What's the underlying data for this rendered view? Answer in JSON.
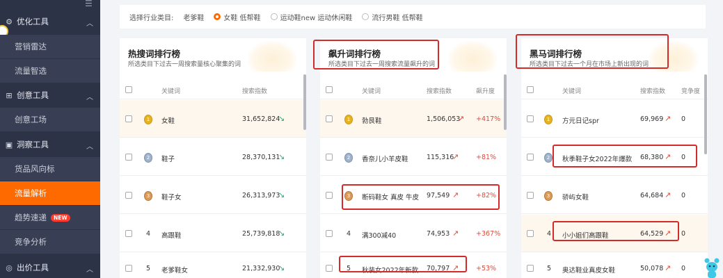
{
  "sidebar": {
    "groups": [
      {
        "label": "优化工具",
        "icon": "gear-icon"
      },
      {
        "label": "创意工具",
        "icon": "idea-icon"
      },
      {
        "label": "洞察工具",
        "icon": "insight-icon"
      },
      {
        "label": "出价工具",
        "icon": "bid-icon"
      }
    ],
    "items": [
      {
        "label": "营销雷达"
      },
      {
        "label": "流量智选"
      },
      {
        "label": "创意工场"
      },
      {
        "label": "货品风向标"
      },
      {
        "label": "流量解析"
      },
      {
        "label": "趋势速递",
        "badge": "NEW"
      },
      {
        "label": "竞争分析"
      }
    ],
    "active_color": "#ff6a00"
  },
  "filter": {
    "label": "选择行业类目:",
    "category": "老爹鞋",
    "options": [
      {
        "label": "女鞋 低帮鞋",
        "selected": true
      },
      {
        "label": "运动鞋new 运动休闲鞋",
        "selected": false
      },
      {
        "label": "流行男鞋 低帮鞋",
        "selected": false
      }
    ]
  },
  "cards": [
    {
      "title": "热搜词排行榜",
      "subtitle": "所选类目下过去一周搜索量核心聚集的词",
      "headers": [
        "关键词",
        "搜索指数"
      ],
      "rows": [
        {
          "rank": "1",
          "keyword": "女鞋",
          "index": "31,652,824",
          "trend": "down"
        },
        {
          "rank": "2",
          "keyword": "鞋子",
          "index": "28,370,131",
          "trend": "down"
        },
        {
          "rank": "3",
          "keyword": "鞋子女",
          "index": "26,313,973",
          "trend": "down"
        },
        {
          "rank": "4",
          "keyword": "高跟鞋",
          "index": "25,739,818",
          "trend": "down"
        },
        {
          "rank": "5",
          "keyword": "老爹鞋女",
          "index": "21,332,930",
          "trend": "down"
        }
      ]
    },
    {
      "title": "飙升词排行榜",
      "subtitle": "所选类目下过去一周搜索流量飙升的词",
      "headers": [
        "关键词",
        "搜索指数",
        "飙升度"
      ],
      "rows": [
        {
          "rank": "1",
          "keyword": "勃艮鞋",
          "index": "1,506,053",
          "trend": "up",
          "rise": "+417%"
        },
        {
          "rank": "2",
          "keyword": "香奈儿小羊皮鞋",
          "index": "115,316",
          "trend": "up",
          "rise": "+81%"
        },
        {
          "rank": "3",
          "keyword": "断码鞋女 真皮 牛皮",
          "index": "97,549",
          "trend": "up",
          "rise": "+82%"
        },
        {
          "rank": "4",
          "keyword": "满300减40",
          "index": "74,953",
          "trend": "up",
          "rise": "+367%"
        },
        {
          "rank": "5",
          "keyword": "秋装女2022年新款",
          "index": "70,797",
          "trend": "up",
          "rise": "+53%"
        }
      ]
    },
    {
      "title": "黑马词排行榜",
      "subtitle": "所选类目下过去一个月在市场上新出现的词",
      "headers": [
        "关键词",
        "搜索指数",
        "竞争度"
      ],
      "rows": [
        {
          "rank": "1",
          "keyword": "方元日记spr",
          "index": "69,969",
          "trend": "up",
          "comp": "0"
        },
        {
          "rank": "2",
          "keyword": "秋季鞋子女2022年爆款",
          "index": "68,380",
          "trend": "up",
          "comp": "0"
        },
        {
          "rank": "3",
          "keyword": "骄屿女鞋",
          "index": "64,684",
          "trend": "up",
          "comp": "0"
        },
        {
          "rank": "4",
          "keyword": "小小姐们高跟鞋",
          "index": "64,529",
          "trend": "up",
          "comp": "0"
        },
        {
          "rank": "5",
          "keyword": "奥达鞋业真皮女鞋",
          "index": "50,078",
          "trend": "up",
          "comp": "0"
        }
      ]
    }
  ],
  "icons": {
    "trend_down": "↘",
    "trend_up": "↗",
    "chevron": "︿",
    "collapse": "☰"
  },
  "colors": {
    "accent": "#ff6a00",
    "annotation": "#d42a2a",
    "down": "#2aa876",
    "up": "#e04a3a"
  }
}
